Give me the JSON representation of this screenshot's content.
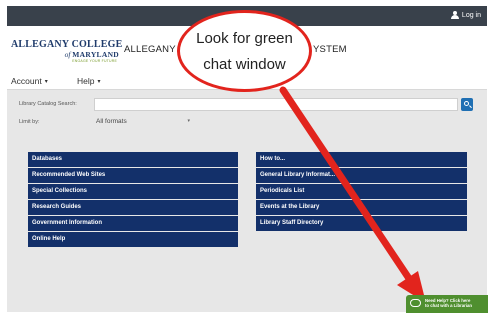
{
  "topbar": {
    "login_label": "Log in"
  },
  "header": {
    "logo": {
      "line1": "ALLEGANY COLLEGE",
      "line2_prefix": "of",
      "line2_main": "MARYLAND",
      "line3": "ENGAGE YOUR FUTURE"
    },
    "site_title_part1": "ALLEGANY CO",
    "site_title_part2": "YSTEM"
  },
  "nav": {
    "items": [
      {
        "label": "Account",
        "caret": "▾"
      },
      {
        "label": "Help",
        "caret": "▾"
      }
    ]
  },
  "search": {
    "label": "Library Catalog Search:",
    "placeholder": ""
  },
  "limit": {
    "label": "Limit by:",
    "selected": "All formats"
  },
  "links": {
    "left": [
      "Databases",
      "Recommended Web Sites",
      "Special Collections",
      "Research Guides",
      "Government Information",
      "Online Help"
    ],
    "right": [
      "How to...",
      "General Library Informat...",
      "Periodicals List",
      "Events at the Library",
      "Library Staff Directory"
    ]
  },
  "callout": {
    "line1": "Look for green",
    "line2": "chat window"
  },
  "chat": {
    "line1": "Need Help? Click here",
    "line2": "to chat with a Librarian"
  },
  "colors": {
    "topbar": "#39414b",
    "link_bg": "#13306a",
    "callout_border": "#e2241d",
    "chat_bg": "#4f8f2f",
    "search_btn": "#1f6fb3"
  },
  "icons": {
    "login": "user-icon",
    "search": "search-icon",
    "chat": "chat-bubble-icon",
    "arrow": "red-arrow"
  }
}
